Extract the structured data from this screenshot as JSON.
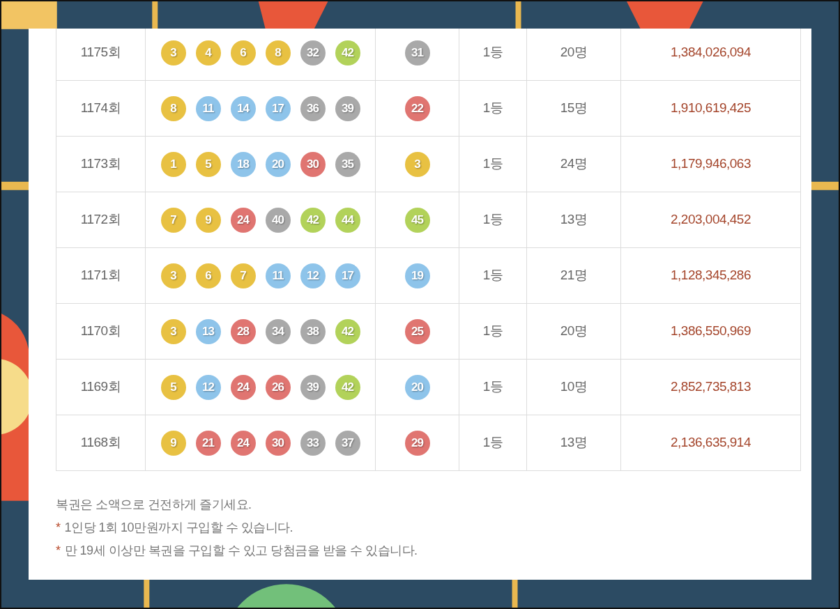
{
  "draws": [
    {
      "round": "1175회",
      "balls": [
        {
          "number": "3",
          "color": "#e8c142"
        },
        {
          "number": "4",
          "color": "#e8c142"
        },
        {
          "number": "6",
          "color": "#e8c142"
        },
        {
          "number": "8",
          "color": "#e8c142"
        },
        {
          "number": "32",
          "color": "#a9a9a9"
        },
        {
          "number": "42",
          "color": "#b2d25a"
        }
      ],
      "bonus": {
        "number": "31",
        "color": "#a9a9a9"
      },
      "rank": "1등",
      "winners": "20명",
      "prize": "1,384,026,094"
    },
    {
      "round": "1174회",
      "balls": [
        {
          "number": "8",
          "color": "#e8c142"
        },
        {
          "number": "11",
          "color": "#8ec4ea"
        },
        {
          "number": "14",
          "color": "#8ec4ea"
        },
        {
          "number": "17",
          "color": "#8ec4ea"
        },
        {
          "number": "36",
          "color": "#a9a9a9"
        },
        {
          "number": "39",
          "color": "#a9a9a9"
        }
      ],
      "bonus": {
        "number": "22",
        "color": "#e07571"
      },
      "rank": "1등",
      "winners": "15명",
      "prize": "1,910,619,425"
    },
    {
      "round": "1173회",
      "balls": [
        {
          "number": "1",
          "color": "#e8c142"
        },
        {
          "number": "5",
          "color": "#e8c142"
        },
        {
          "number": "18",
          "color": "#8ec4ea"
        },
        {
          "number": "20",
          "color": "#8ec4ea"
        },
        {
          "number": "30",
          "color": "#e07571"
        },
        {
          "number": "35",
          "color": "#a9a9a9"
        }
      ],
      "bonus": {
        "number": "3",
        "color": "#e8c142"
      },
      "rank": "1등",
      "winners": "24명",
      "prize": "1,179,946,063"
    },
    {
      "round": "1172회",
      "balls": [
        {
          "number": "7",
          "color": "#e8c142"
        },
        {
          "number": "9",
          "color": "#e8c142"
        },
        {
          "number": "24",
          "color": "#e07571"
        },
        {
          "number": "40",
          "color": "#a9a9a9"
        },
        {
          "number": "42",
          "color": "#b2d25a"
        },
        {
          "number": "44",
          "color": "#b2d25a"
        }
      ],
      "bonus": {
        "number": "45",
        "color": "#b2d25a"
      },
      "rank": "1등",
      "winners": "13명",
      "prize": "2,203,004,452"
    },
    {
      "round": "1171회",
      "balls": [
        {
          "number": "3",
          "color": "#e8c142"
        },
        {
          "number": "6",
          "color": "#e8c142"
        },
        {
          "number": "7",
          "color": "#e8c142"
        },
        {
          "number": "11",
          "color": "#8ec4ea"
        },
        {
          "number": "12",
          "color": "#8ec4ea"
        },
        {
          "number": "17",
          "color": "#8ec4ea"
        }
      ],
      "bonus": {
        "number": "19",
        "color": "#8ec4ea"
      },
      "rank": "1등",
      "winners": "21명",
      "prize": "1,128,345,286"
    },
    {
      "round": "1170회",
      "balls": [
        {
          "number": "3",
          "color": "#e8c142"
        },
        {
          "number": "13",
          "color": "#8ec4ea"
        },
        {
          "number": "28",
          "color": "#e07571"
        },
        {
          "number": "34",
          "color": "#a9a9a9"
        },
        {
          "number": "38",
          "color": "#a9a9a9"
        },
        {
          "number": "42",
          "color": "#b2d25a"
        }
      ],
      "bonus": {
        "number": "25",
        "color": "#e07571"
      },
      "rank": "1등",
      "winners": "20명",
      "prize": "1,386,550,969"
    },
    {
      "round": "1169회",
      "balls": [
        {
          "number": "5",
          "color": "#e8c142"
        },
        {
          "number": "12",
          "color": "#8ec4ea"
        },
        {
          "number": "24",
          "color": "#e07571"
        },
        {
          "number": "26",
          "color": "#e07571"
        },
        {
          "number": "39",
          "color": "#a9a9a9"
        },
        {
          "number": "42",
          "color": "#b2d25a"
        }
      ],
      "bonus": {
        "number": "20",
        "color": "#8ec4ea"
      },
      "rank": "1등",
      "winners": "10명",
      "prize": "2,852,735,813"
    },
    {
      "round": "1168회",
      "balls": [
        {
          "number": "9",
          "color": "#e8c142"
        },
        {
          "number": "21",
          "color": "#e07571"
        },
        {
          "number": "24",
          "color": "#e07571"
        },
        {
          "number": "30",
          "color": "#e07571"
        },
        {
          "number": "33",
          "color": "#a9a9a9"
        },
        {
          "number": "37",
          "color": "#a9a9a9"
        }
      ],
      "bonus": {
        "number": "29",
        "color": "#e07571"
      },
      "rank": "1등",
      "winners": "13명",
      "prize": "2,136,635,914"
    }
  ],
  "notes": [
    {
      "text": "복권은 소액으로 건전하게 즐기세요."
    },
    {
      "marker": "*",
      "text": "1인당 1회 10만원까지 구입할 수 있습니다."
    },
    {
      "marker": "*",
      "text": "만 19세 이상만 복권을 구입할 수 있고 당첨금을 받을 수 있습니다."
    }
  ]
}
